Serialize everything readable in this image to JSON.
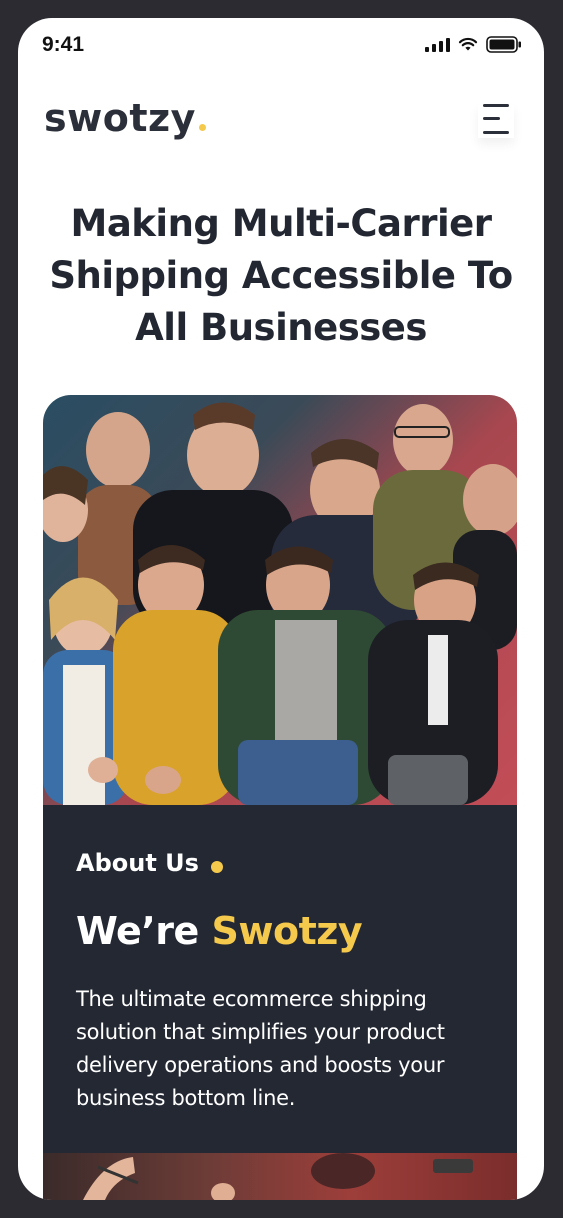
{
  "status_bar": {
    "time": "9:41",
    "icons": [
      "signal-icon",
      "wifi-icon",
      "battery-icon"
    ]
  },
  "header": {
    "logo_text": "swotzy",
    "menu_icon": "hamburger-menu-icon"
  },
  "hero": {
    "title": "Making Multi-Carrier Shipping Accessible To All Businesses"
  },
  "about": {
    "label": "About Us",
    "heading_prefix": "We’re ",
    "heading_brand": "Swotzy",
    "description": "The ultimate ecommerce shipping solution that simplifies your product delivery operations and boosts your business bottom line."
  },
  "colors": {
    "accent": "#f5c94b",
    "dark": "#232833",
    "text_dark": "#222732"
  }
}
